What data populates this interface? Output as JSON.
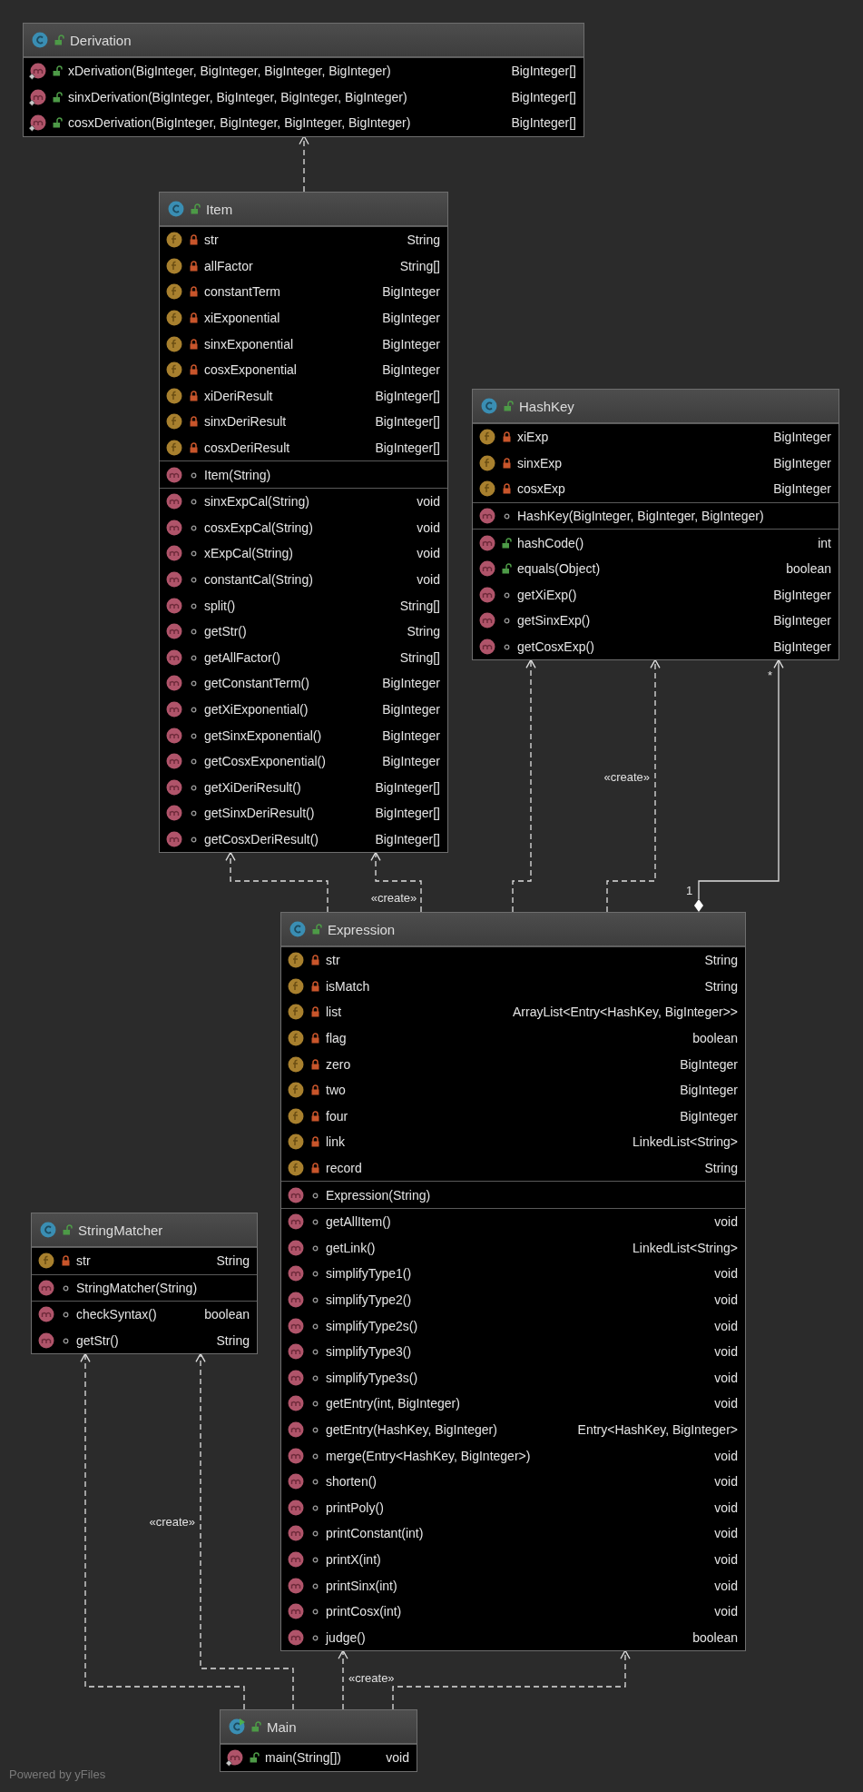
{
  "diagram": {
    "classes": [
      {
        "name": "Derivation",
        "kind": "public",
        "methods": [
          {
            "name": "xDerivation(BigInteger, BigInteger, BigInteger, BigInteger)",
            "type": "BigInteger[]",
            "kind": "public",
            "static": true
          },
          {
            "name": "sinxDerivation(BigInteger, BigInteger, BigInteger, BigInteger)",
            "type": "BigInteger[]",
            "kind": "public",
            "static": true
          },
          {
            "name": "cosxDerivation(BigInteger, BigInteger, BigInteger, BigInteger)",
            "type": "BigInteger[]",
            "kind": "public",
            "static": true
          }
        ]
      },
      {
        "name": "Item",
        "kind": "public",
        "fields": [
          {
            "name": "str",
            "type": "String",
            "kind": "private"
          },
          {
            "name": "allFactor",
            "type": "String[]",
            "kind": "private"
          },
          {
            "name": "constantTerm",
            "type": "BigInteger",
            "kind": "private"
          },
          {
            "name": "xiExponential",
            "type": "BigInteger",
            "kind": "private"
          },
          {
            "name": "sinxExponential",
            "type": "BigInteger",
            "kind": "private"
          },
          {
            "name": "cosxExponential",
            "type": "BigInteger",
            "kind": "private"
          },
          {
            "name": "xiDeriResult",
            "type": "BigInteger[]",
            "kind": "private"
          },
          {
            "name": "sinxDeriResult",
            "type": "BigInteger[]",
            "kind": "private"
          },
          {
            "name": "cosxDeriResult",
            "type": "BigInteger[]",
            "kind": "private"
          }
        ],
        "constructors": [
          {
            "name": "Item(String)",
            "kind": "package"
          }
        ],
        "methods": [
          {
            "name": "sinxExpCal(String)",
            "type": "void",
            "kind": "package"
          },
          {
            "name": "cosxExpCal(String)",
            "type": "void",
            "kind": "package"
          },
          {
            "name": "xExpCal(String)",
            "type": "void",
            "kind": "package"
          },
          {
            "name": "constantCal(String)",
            "type": "void",
            "kind": "package"
          },
          {
            "name": "split()",
            "type": "String[]",
            "kind": "package"
          },
          {
            "name": "getStr()",
            "type": "String",
            "kind": "package"
          },
          {
            "name": "getAllFactor()",
            "type": "String[]",
            "kind": "package"
          },
          {
            "name": "getConstantTerm()",
            "type": "BigInteger",
            "kind": "package"
          },
          {
            "name": "getXiExponential()",
            "type": "BigInteger",
            "kind": "package"
          },
          {
            "name": "getSinxExponential()",
            "type": "BigInteger",
            "kind": "package"
          },
          {
            "name": "getCosxExponential()",
            "type": "BigInteger",
            "kind": "package"
          },
          {
            "name": "getXiDeriResult()",
            "type": "BigInteger[]",
            "kind": "package"
          },
          {
            "name": "getSinxDeriResult()",
            "type": "BigInteger[]",
            "kind": "package"
          },
          {
            "name": "getCosxDeriResult()",
            "type": "BigInteger[]",
            "kind": "package"
          }
        ]
      },
      {
        "name": "HashKey",
        "kind": "public",
        "fields": [
          {
            "name": "xiExp",
            "type": "BigInteger",
            "kind": "private"
          },
          {
            "name": "sinxExp",
            "type": "BigInteger",
            "kind": "private"
          },
          {
            "name": "cosxExp",
            "type": "BigInteger",
            "kind": "private"
          }
        ],
        "constructors": [
          {
            "name": "HashKey(BigInteger, BigInteger, BigInteger)",
            "kind": "package"
          }
        ],
        "methods": [
          {
            "name": "hashCode()",
            "type": "int",
            "kind": "public"
          },
          {
            "name": "equals(Object)",
            "type": "boolean",
            "kind": "public"
          },
          {
            "name": "getXiExp()",
            "type": "BigInteger",
            "kind": "package"
          },
          {
            "name": "getSinxExp()",
            "type": "BigInteger",
            "kind": "package"
          },
          {
            "name": "getCosxExp()",
            "type": "BigInteger",
            "kind": "package"
          }
        ]
      },
      {
        "name": "StringMatcher",
        "kind": "public",
        "fields": [
          {
            "name": "str",
            "type": "String",
            "kind": "private"
          }
        ],
        "constructors": [
          {
            "name": "StringMatcher(String)",
            "kind": "package"
          }
        ],
        "methods": [
          {
            "name": "checkSyntax()",
            "type": "boolean",
            "kind": "package"
          },
          {
            "name": "getStr()",
            "type": "String",
            "kind": "package"
          }
        ]
      },
      {
        "name": "Expression",
        "kind": "public",
        "fields": [
          {
            "name": "str",
            "type": "String",
            "kind": "private"
          },
          {
            "name": "isMatch",
            "type": "String",
            "kind": "private"
          },
          {
            "name": "list",
            "type": "ArrayList<Entry<HashKey, BigInteger>>",
            "kind": "private"
          },
          {
            "name": "flag",
            "type": "boolean",
            "kind": "private"
          },
          {
            "name": "zero",
            "type": "BigInteger",
            "kind": "private"
          },
          {
            "name": "two",
            "type": "BigInteger",
            "kind": "private"
          },
          {
            "name": "four",
            "type": "BigInteger",
            "kind": "private"
          },
          {
            "name": "link",
            "type": "LinkedList<String>",
            "kind": "private"
          },
          {
            "name": "record",
            "type": "String",
            "kind": "private"
          }
        ],
        "constructors": [
          {
            "name": "Expression(String)",
            "kind": "package"
          }
        ],
        "methods": [
          {
            "name": "getAllItem()",
            "type": "void",
            "kind": "package"
          },
          {
            "name": "getLink()",
            "type": "LinkedList<String>",
            "kind": "package"
          },
          {
            "name": "simplifyType1()",
            "type": "void",
            "kind": "package"
          },
          {
            "name": "simplifyType2()",
            "type": "void",
            "kind": "package"
          },
          {
            "name": "simplifyType2s()",
            "type": "void",
            "kind": "package"
          },
          {
            "name": "simplifyType3()",
            "type": "void",
            "kind": "package"
          },
          {
            "name": "simplifyType3s()",
            "type": "void",
            "kind": "package"
          },
          {
            "name": "getEntry(int, BigInteger)",
            "type": "void",
            "kind": "package"
          },
          {
            "name": "getEntry(HashKey, BigInteger)",
            "type": "Entry<HashKey, BigInteger>",
            "kind": "package"
          },
          {
            "name": "merge(Entry<HashKey, BigInteger>)",
            "type": "void",
            "kind": "package"
          },
          {
            "name": "shorten()",
            "type": "void",
            "kind": "package"
          },
          {
            "name": "printPoly()",
            "type": "void",
            "kind": "package"
          },
          {
            "name": "printConstant(int)",
            "type": "void",
            "kind": "package"
          },
          {
            "name": "printX(int)",
            "type": "void",
            "kind": "package"
          },
          {
            "name": "printSinx(int)",
            "type": "void",
            "kind": "package"
          },
          {
            "name": "printCosx(int)",
            "type": "void",
            "kind": "package"
          },
          {
            "name": "judge()",
            "type": "boolean",
            "kind": "package"
          }
        ]
      },
      {
        "name": "Main",
        "kind": "public",
        "runnable": true,
        "methods": [
          {
            "name": "main(String[])",
            "type": "void",
            "kind": "public",
            "static": true
          }
        ]
      }
    ],
    "edges": [
      {
        "kind": "dependency"
      },
      {
        "kind": "dependency"
      },
      {
        "kind": "dependency",
        "label": "«create»"
      },
      {
        "kind": "dependency"
      },
      {
        "kind": "dependency",
        "label": "«create»"
      },
      {
        "kind": "composition",
        "source_multiplicity": "1",
        "target_multiplicity": "*"
      },
      {
        "kind": "dependency"
      },
      {
        "kind": "dependency",
        "label": "«create»"
      },
      {
        "kind": "dependency",
        "label": "«create»"
      },
      {
        "kind": "dependency"
      }
    ]
  },
  "footer": "Powered by yFiles"
}
